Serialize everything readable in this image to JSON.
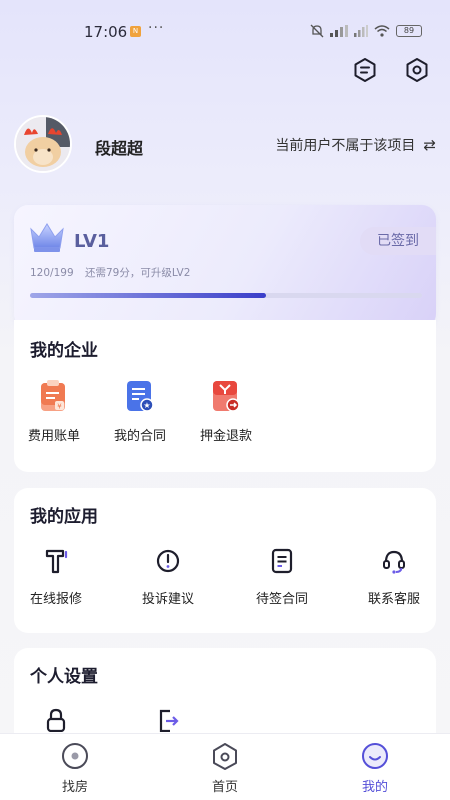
{
  "status_bar": {
    "time": "17:06",
    "app_badge": "N",
    "dots": "···",
    "battery": "89"
  },
  "profile": {
    "username": "段超超",
    "project_text": "当前用户不属于该项目",
    "switch_icon": "⇄"
  },
  "level": {
    "label": "LV1",
    "signed_label": "已签到",
    "points": "120/199",
    "hint": "还需79分，可升级LV2",
    "progress_fraction": 0.603
  },
  "enterprise": {
    "title": "我的企业",
    "items": [
      {
        "label": "费用账单",
        "icon": "bill-icon"
      },
      {
        "label": "我的合同",
        "icon": "contract-icon"
      },
      {
        "label": "押金退款",
        "icon": "deposit-refund-icon"
      }
    ]
  },
  "apps": {
    "title": "我的应用",
    "items": [
      {
        "label": "在线报修",
        "icon": "repair-icon"
      },
      {
        "label": "投诉建议",
        "icon": "complaint-icon"
      },
      {
        "label": "待签合同",
        "icon": "pending-contract-icon"
      },
      {
        "label": "联系客服",
        "icon": "customer-service-icon"
      }
    ]
  },
  "settings": {
    "title": "个人设置",
    "items": [
      {
        "icon": "lock-icon"
      },
      {
        "icon": "logout-icon"
      }
    ]
  },
  "tabbar": {
    "items": [
      {
        "label": "找房",
        "icon": "find-room-icon"
      },
      {
        "label": "首页",
        "icon": "home-icon"
      },
      {
        "label": "我的",
        "icon": "mine-icon",
        "active": true
      }
    ]
  },
  "colors": {
    "accent": "#5550d8",
    "progress": "#3a3ec9",
    "bill_orange": "#f07a52",
    "contract_blue": "#4a73e8",
    "refund_red": "#e8483e"
  }
}
